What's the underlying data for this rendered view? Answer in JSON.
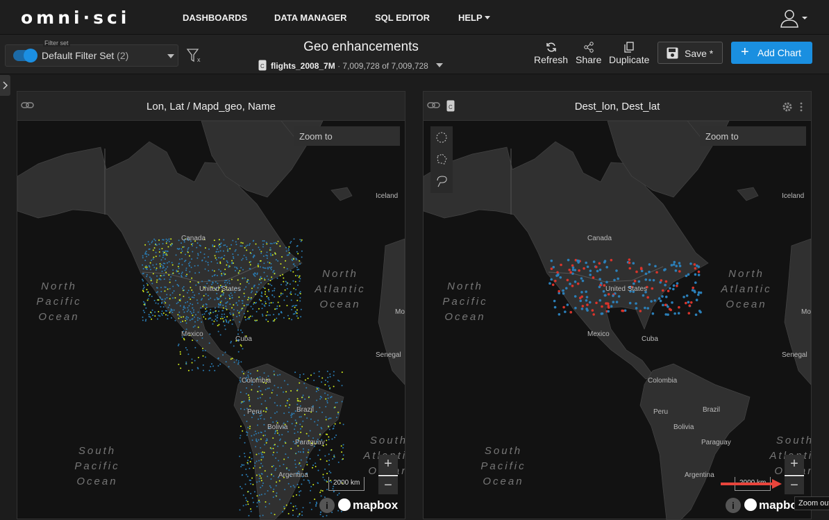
{
  "nav": {
    "logo": "omni·sci",
    "items": [
      "DASHBOARDS",
      "DATA MANAGER",
      "SQL EDITOR",
      "HELP"
    ]
  },
  "toolbar": {
    "filter_label": "Filter set",
    "filter_value": "Default Filter Set",
    "filter_count": "(2)",
    "title": "Geo enhancements",
    "source_name": "flights_2008_7M",
    "source_count": "· 7,009,728 of 7,009,728",
    "refresh": "Refresh",
    "share": "Share",
    "duplicate": "Duplicate",
    "save": "Save *",
    "add_chart": "Add Chart"
  },
  "colors": {
    "accent": "#1a8fe0",
    "land": "#303030",
    "water": "#121212",
    "dot_blue": "#2b7fb8",
    "dot_yellow": "#d6f01c",
    "dot_red": "#d9342b",
    "arrow": "#e8453c"
  },
  "panels": [
    {
      "title": "Lon, Lat / Mapd_geo, Name",
      "zoom_to": "Zoom to",
      "scale": "2000 km",
      "attribution": "mapbox",
      "dots": "blue-yellow"
    },
    {
      "title": "Dest_lon, Dest_lat",
      "zoom_to": "Zoom to",
      "scale": "2000 km",
      "attribution": "mapbox",
      "dots": "blue-red"
    }
  ],
  "map_labels": {
    "countries": [
      "Canada",
      "United States",
      "Mexico",
      "Cuba",
      "Colombia",
      "Peru",
      "Brazil",
      "Bolivia",
      "Paraguay",
      "Argentina",
      "Iceland",
      "Senegal",
      "Mo"
    ],
    "oceans": [
      "North Pacific Ocean",
      "North Atlantic Ocean",
      "South Pacific Ocean",
      "South Atlantic Ocean"
    ]
  },
  "map_controls": {
    "zoom_in": "+",
    "zoom_out": "−"
  },
  "tooltip": "Zoom out"
}
